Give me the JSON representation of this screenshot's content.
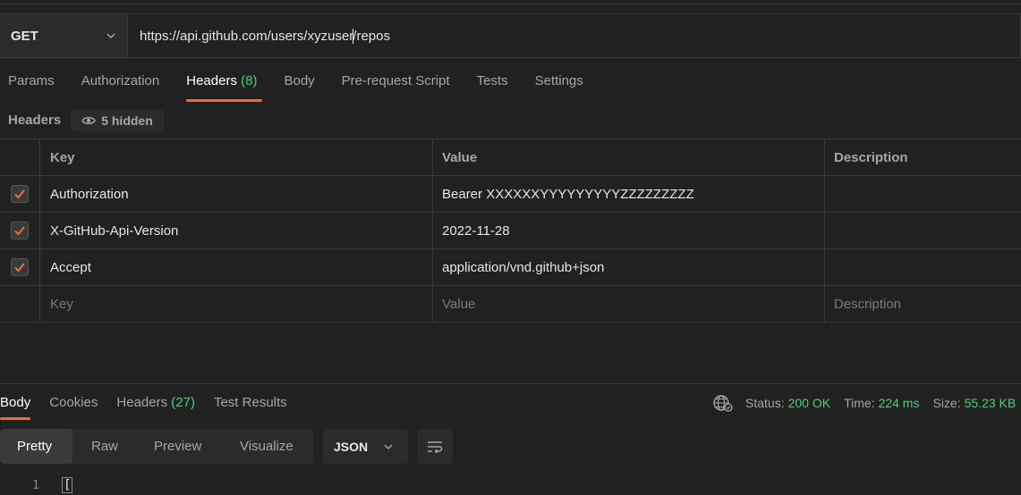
{
  "request": {
    "method": "GET",
    "url_before_caret": "https://api.github.com/users/xyzuser",
    "url_after_caret": "/repos"
  },
  "request_tabs": [
    {
      "label": "Params",
      "count": ""
    },
    {
      "label": "Authorization",
      "count": ""
    },
    {
      "label": "Headers",
      "count": "(8)"
    },
    {
      "label": "Body",
      "count": ""
    },
    {
      "label": "Pre-request Script",
      "count": ""
    },
    {
      "label": "Tests",
      "count": ""
    },
    {
      "label": "Settings",
      "count": ""
    }
  ],
  "headers_section": {
    "title": "Headers",
    "hidden_label": "5 hidden"
  },
  "table": {
    "columns": [
      "Key",
      "Value",
      "Description"
    ],
    "rows": [
      {
        "key": "Authorization",
        "value": "Bearer XXXXXXYYYYYYYYYZZZZZZZZZ",
        "description": "",
        "checked": true
      },
      {
        "key": "X-GitHub-Api-Version",
        "value": "2022-11-28",
        "description": "",
        "checked": true
      },
      {
        "key": "Accept",
        "value": "application/vnd.github+json",
        "description": "",
        "checked": true
      }
    ],
    "placeholder": {
      "key": "Key",
      "value": "Value",
      "description": "Description"
    }
  },
  "response_tabs": [
    {
      "label": "Body",
      "count": ""
    },
    {
      "label": "Cookies",
      "count": ""
    },
    {
      "label": "Headers",
      "count": "(27)"
    },
    {
      "label": "Test Results",
      "count": ""
    }
  ],
  "response_status": {
    "status_label": "Status:",
    "status_value": "200 OK",
    "time_label": "Time:",
    "time_value": "224 ms",
    "size_label": "Size:",
    "size_value": "55.23 KB"
  },
  "view_options": [
    "Pretty",
    "Raw",
    "Preview",
    "Visualize"
  ],
  "format": "JSON",
  "code": {
    "line_number": "1",
    "text": "["
  },
  "colors": {
    "accent": "#f26b3a",
    "success": "#4dcf85",
    "background": "#212121",
    "panel": "#2b2b2b"
  },
  "icons": {
    "method_dropdown": "chevron-down-icon",
    "hidden_headers": "eye-icon",
    "network": "globe-icon",
    "format_dropdown": "chevron-down-icon",
    "wrap": "wrap-lines-icon",
    "checkbox": "check-icon"
  }
}
